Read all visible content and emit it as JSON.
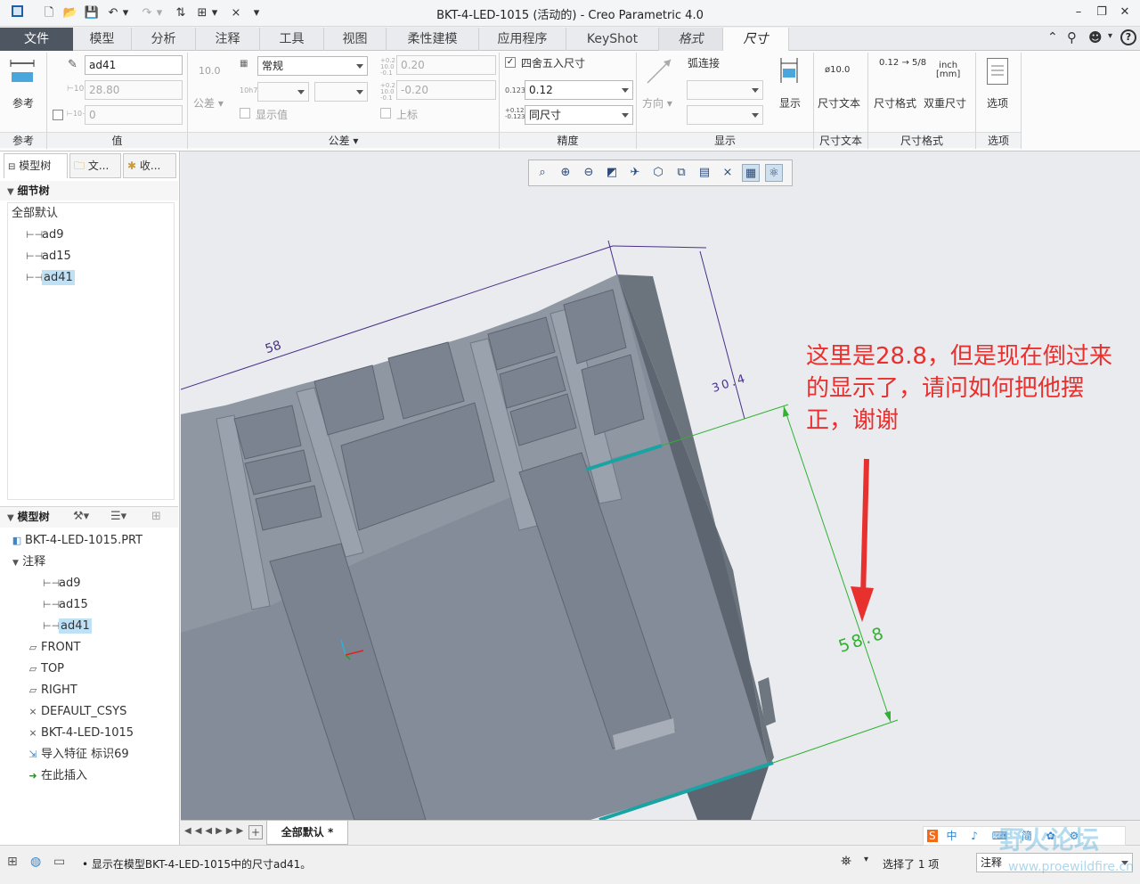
{
  "window": {
    "title": "BKT-4-LED-1015 (活动的) - Creo Parametric 4.0",
    "controls": [
      "–",
      "❐",
      "✕"
    ]
  },
  "quick_access": [
    "▣",
    "☐",
    "📂",
    "💾",
    "↶",
    "▾",
    "↷",
    "▾",
    "⇅",
    "⊞",
    "▾",
    "⨯",
    "▾"
  ],
  "tabs": {
    "file": "文件",
    "items": [
      "模型",
      "分析",
      "注释",
      "工具",
      "视图",
      "柔性建模",
      "应用程序",
      "KeyShot",
      "格式",
      "尺寸"
    ],
    "active": "尺寸"
  },
  "ribbon": {
    "reference": {
      "button_label": "参考",
      "group_label": "参考"
    },
    "value": {
      "name_value": "ad41",
      "value_field": "28.80",
      "third_field": "0",
      "group_label": "值"
    },
    "tolerance": {
      "tol_icon_label": "10.0",
      "tol_button_label": "公差",
      "format_value": "常规",
      "show_value_label": "显示值",
      "upper_value": "0.20",
      "lower_value": "-0.20",
      "superscript_label": "上标",
      "group_label": "公差"
    },
    "precision": {
      "round_label": "四舍五入尺寸",
      "decimals_value": "0.12",
      "dim_type_value": "同尺寸",
      "group_label": "精度"
    },
    "display": {
      "arc_label": "弧连接",
      "direction_label": "方向",
      "show_label": "显示",
      "group_label": "显示"
    },
    "dim_text": {
      "button_label": "尺寸文本",
      "icon_text": "ø10.0",
      "group_label": "尺寸文本"
    },
    "dim_format": {
      "format_label": "尺寸格式",
      "dual_label": "双重尺寸",
      "fraction_text": "0.12 → 5/8",
      "inch_text": "inch",
      "mm_text": "[mm]",
      "group_label": "尺寸格式"
    },
    "options": {
      "button_label": "选项",
      "group_label": "选项"
    }
  },
  "left_panel": {
    "tabs": [
      "模型树",
      "文...",
      "收..."
    ],
    "detail_tree": {
      "header": "细节树",
      "root": "全部默认",
      "items": [
        "ad9",
        "ad15",
        "ad41"
      ],
      "selected": "ad41"
    },
    "model_tree": {
      "header": "模型树",
      "part": "BKT-4-LED-1015.PRT",
      "annotations": "注释",
      "ann_items": [
        "ad9",
        "ad15",
        "ad41"
      ],
      "others": [
        "FRONT",
        "TOP",
        "RIGHT",
        "DEFAULT_CSYS",
        "BKT-4-LED-1015",
        "导入特征 标识69",
        "在此插入"
      ]
    }
  },
  "viewport": {
    "dims": {
      "d58": "58",
      "d30": "30.4",
      "d588": "58.8"
    },
    "annotation": [
      "这里是28.8，但是现在倒过来",
      "的显示了，请问如何把他摆",
      "正，谢谢"
    ]
  },
  "bottom_bar": {
    "sheet_tab": "全部默认 *"
  },
  "status": {
    "message": "显示在模型BKT-4-LED-1015中的尺寸ad41。",
    "selection": "选择了 1 项",
    "filter": "注释",
    "watermark": "野火论坛",
    "watermark_url": "www.proewildfire.cn"
  }
}
